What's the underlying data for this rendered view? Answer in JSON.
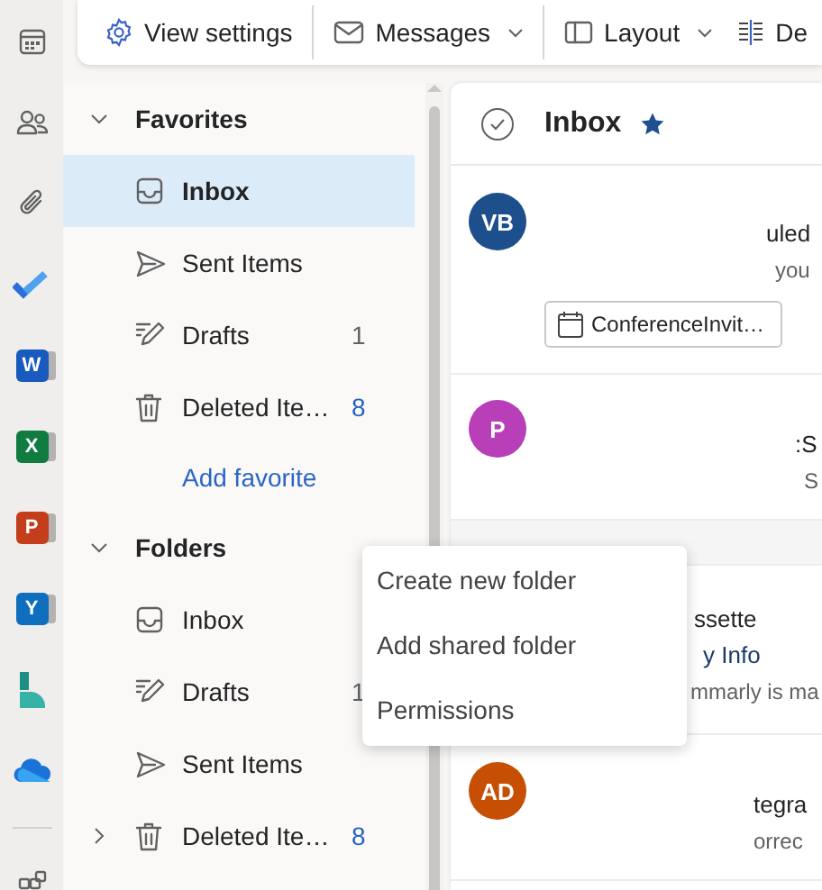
{
  "app_rail": {
    "items": [
      {
        "kind": "calendar"
      },
      {
        "kind": "people"
      },
      {
        "kind": "files"
      },
      {
        "kind": "todo"
      },
      {
        "kind": "tile",
        "letter": "W",
        "color": "#185abd"
      },
      {
        "kind": "tile",
        "letter": "X",
        "color": "#107c41"
      },
      {
        "kind": "tile",
        "letter": "P",
        "color": "#c43e1c"
      },
      {
        "kind": "tile",
        "letter": "Y",
        "color": "#106ebe"
      },
      {
        "kind": "bookings"
      },
      {
        "kind": "cloud"
      },
      {
        "kind": "divider"
      },
      {
        "kind": "apps"
      }
    ]
  },
  "toolbar": {
    "buttons": [
      {
        "kind": "settings",
        "label": "View settings",
        "dropdown": false,
        "divider_after": true
      },
      {
        "kind": "mail",
        "label": "Messages",
        "dropdown": true,
        "divider_after": true
      },
      {
        "kind": "layout",
        "label": "Layout",
        "dropdown": true,
        "divider_after": false
      },
      {
        "kind": "density",
        "label": "De",
        "dropdown": false,
        "divider_after": false
      }
    ]
  },
  "folder_pane": {
    "sections": [
      {
        "title": "Favorites",
        "expanded": true,
        "action": "Add favorite",
        "items": [
          {
            "kind": "inbox",
            "label": "Inbox",
            "selected": true,
            "expandable": false
          },
          {
            "kind": "sent",
            "label": "Sent Items",
            "selected": false,
            "expandable": false
          },
          {
            "kind": "drafts",
            "label": "Drafts",
            "count": "1",
            "unread": false,
            "selected": false,
            "expandable": false
          },
          {
            "kind": "deleted",
            "label": "Deleted Ite…",
            "count": "8",
            "unread": true,
            "selected": false,
            "expandable": false
          }
        ]
      },
      {
        "title": "Folders",
        "expanded": true,
        "items": [
          {
            "kind": "inbox",
            "label": "Inbox",
            "selected": false,
            "expandable": false
          },
          {
            "kind": "drafts",
            "label": "Drafts",
            "count": "1",
            "unread": false,
            "selected": false,
            "expandable": false
          },
          {
            "kind": "sent",
            "label": "Sent Items",
            "selected": false,
            "expandable": false
          },
          {
            "kind": "deleted",
            "label": "Deleted Ite…",
            "count": "8",
            "unread": true,
            "selected": false,
            "expandable": true
          }
        ]
      }
    ]
  },
  "message_list": {
    "title": "Inbox",
    "favorite": true,
    "messages": [
      {
        "initials": "VB",
        "color": "#1c4f8c",
        "lines": [
          {
            "kind": "subject",
            "text": "uled"
          },
          {
            "kind": "preview",
            "text": "you"
          }
        ],
        "attachment": "ConferenceInvit…"
      },
      {
        "initials": "P",
        "color": "#b83fb8",
        "lines": [
          {
            "kind": "subject",
            "text": ":S"
          },
          {
            "kind": "preview",
            "text": "S"
          }
        ]
      },
      {
        "lines": [
          {
            "kind": "sender",
            "text": "ssette"
          },
          {
            "kind": "subject",
            "text": "y Info"
          },
          {
            "kind": "preview",
            "text": "mmarly is ma"
          }
        ]
      },
      {
        "initials": "AD",
        "color": "#c64f03",
        "lines": [
          {
            "kind": "subject",
            "text": "tegra"
          },
          {
            "kind": "preview",
            "text": "orrec"
          }
        ]
      }
    ]
  },
  "context_menu": {
    "items": [
      "Create new folder",
      "Add shared folder",
      "Permissions"
    ]
  }
}
